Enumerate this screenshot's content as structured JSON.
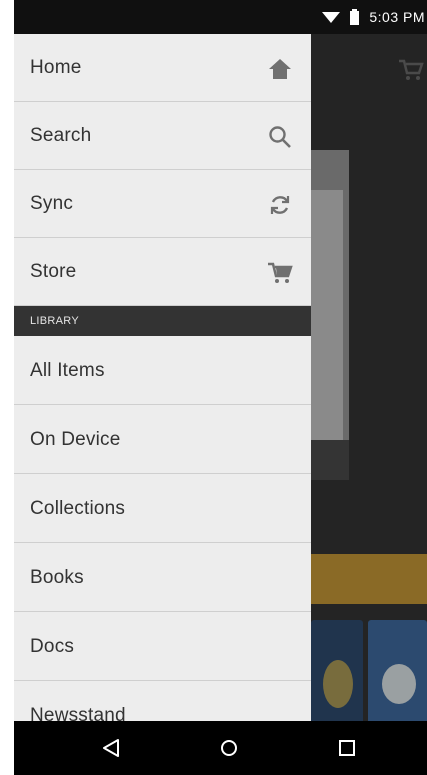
{
  "status_bar": {
    "time": "5:03 PM"
  },
  "drawer": {
    "primary": [
      {
        "label": "Home",
        "icon": "home-icon"
      },
      {
        "label": "Search",
        "icon": "search-icon"
      },
      {
        "label": "Sync",
        "icon": "sync-icon"
      },
      {
        "label": "Store",
        "icon": "cart-icon"
      }
    ],
    "library_header": "LIBRARY",
    "library": [
      {
        "label": "All Items"
      },
      {
        "label": "On Device"
      },
      {
        "label": "Collections"
      },
      {
        "label": "Books"
      },
      {
        "label": "Docs"
      },
      {
        "label": "Newsstand"
      }
    ]
  },
  "nav": {
    "back": "back-icon",
    "home": "home-circle-icon",
    "recents": "recents-icon"
  },
  "colors": {
    "drawer_bg": "#ededed",
    "section_header_bg": "#333333",
    "status_bar_bg": "#101010",
    "nav_bar_bg": "#000000"
  }
}
